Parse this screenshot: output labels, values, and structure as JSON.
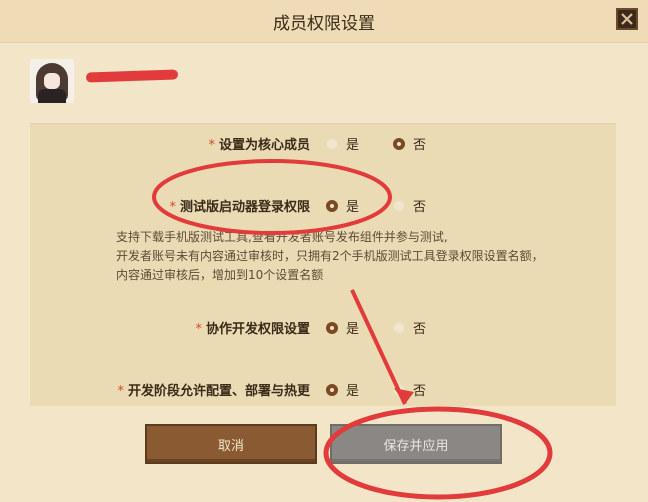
{
  "dialog": {
    "title": "成员权限设置",
    "close_icon": "close-icon"
  },
  "profile": {
    "avatar_icon": "user-avatar"
  },
  "permissions": [
    {
      "label": "设置为核心成员",
      "required_mark": "*",
      "yes": "是",
      "no": "否",
      "selected": "no"
    },
    {
      "label": "测试版启动器登录权限",
      "required_mark": "*",
      "yes": "是",
      "no": "否",
      "selected": "yes"
    },
    {
      "label": "协作开发权限设置",
      "required_mark": "*",
      "yes": "是",
      "no": "否",
      "selected": "yes"
    },
    {
      "label": "开发阶段允许配置、部署与热更",
      "required_mark": "*",
      "yes": "是",
      "no": "否",
      "selected": "yes"
    }
  ],
  "description": {
    "line1": "支持下载手机版测试工具,查看开发者账号发布组件并参与测试,",
    "line2": "开发者账号未有内容通过审核时，只拥有2个手机版测试工具登录权限设置名额，",
    "line3": "内容通过审核后，增加到10个设置名额"
  },
  "buttons": {
    "cancel": "取消",
    "save": "保存并应用"
  },
  "colors": {
    "accent": "#7a4a24",
    "required": "#d24a2a",
    "annotation": "#e23b3b",
    "cancel_bg": "#8a5a33",
    "save_bg": "#8a8784"
  }
}
